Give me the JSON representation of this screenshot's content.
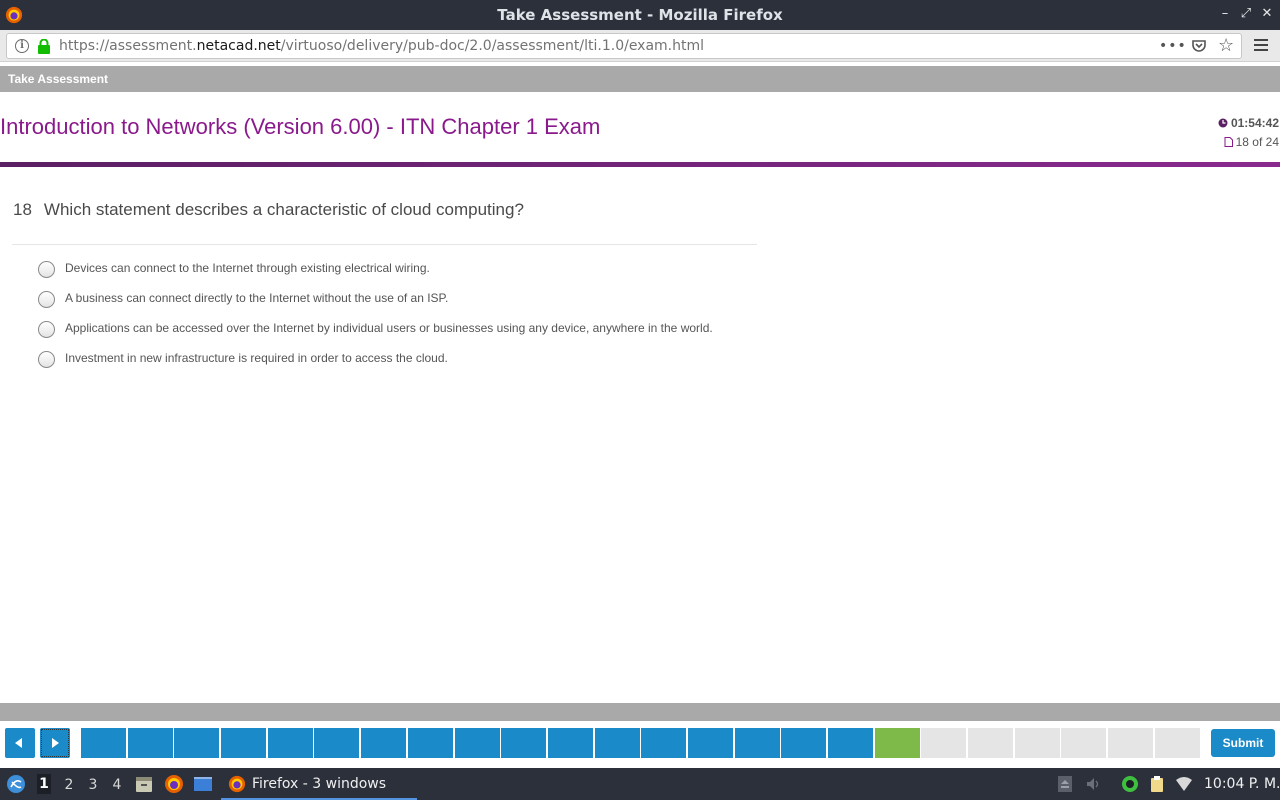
{
  "window": {
    "title": "Take Assessment - Mozilla Firefox",
    "controls": [
      "minimize-icon",
      "maximize-icon",
      "close-icon"
    ]
  },
  "browser": {
    "url_prefix": "https://assessment.",
    "url_host": "netacad.net",
    "url_path": "/virtuoso/delivery/pub-doc/2.0/assessment/lti.1.0/exam.html",
    "more_label": "•••"
  },
  "app": {
    "header": "Take Assessment",
    "exam_title": "Introduction to Networks (Version 6.00) - ITN Chapter 1 Exam",
    "timer": "01:54:42",
    "progress": "18 of 24"
  },
  "question": {
    "number": "18",
    "text": "Which statement describes a characteristic of cloud computing?",
    "options": [
      "Devices can connect to the Internet through existing electrical wiring.",
      "A business can connect directly to the Internet without the use of an ISP.",
      "Applications can be accessed over the Internet by individual users or businesses using any device, anywhere in the world.",
      "Investment in new infrastructure is required in order to access the cloud."
    ]
  },
  "footer": {
    "submit_label": "Submit",
    "total_questions": 24,
    "current_question": 18,
    "colors": {
      "answered": "#1a8ac8",
      "current": "#7dba4a",
      "pending": "#e5e5e5"
    }
  },
  "taskbar": {
    "workspaces": [
      "1",
      "2",
      "3",
      "4"
    ],
    "active_workspace": "1",
    "task_label": "Firefox - 3 windows",
    "clock": "10:04 P. M."
  },
  "colors": {
    "accent_purple": "#8a1a8c",
    "primary_blue": "#1a8ac8",
    "titlebar": "#2b303b"
  }
}
